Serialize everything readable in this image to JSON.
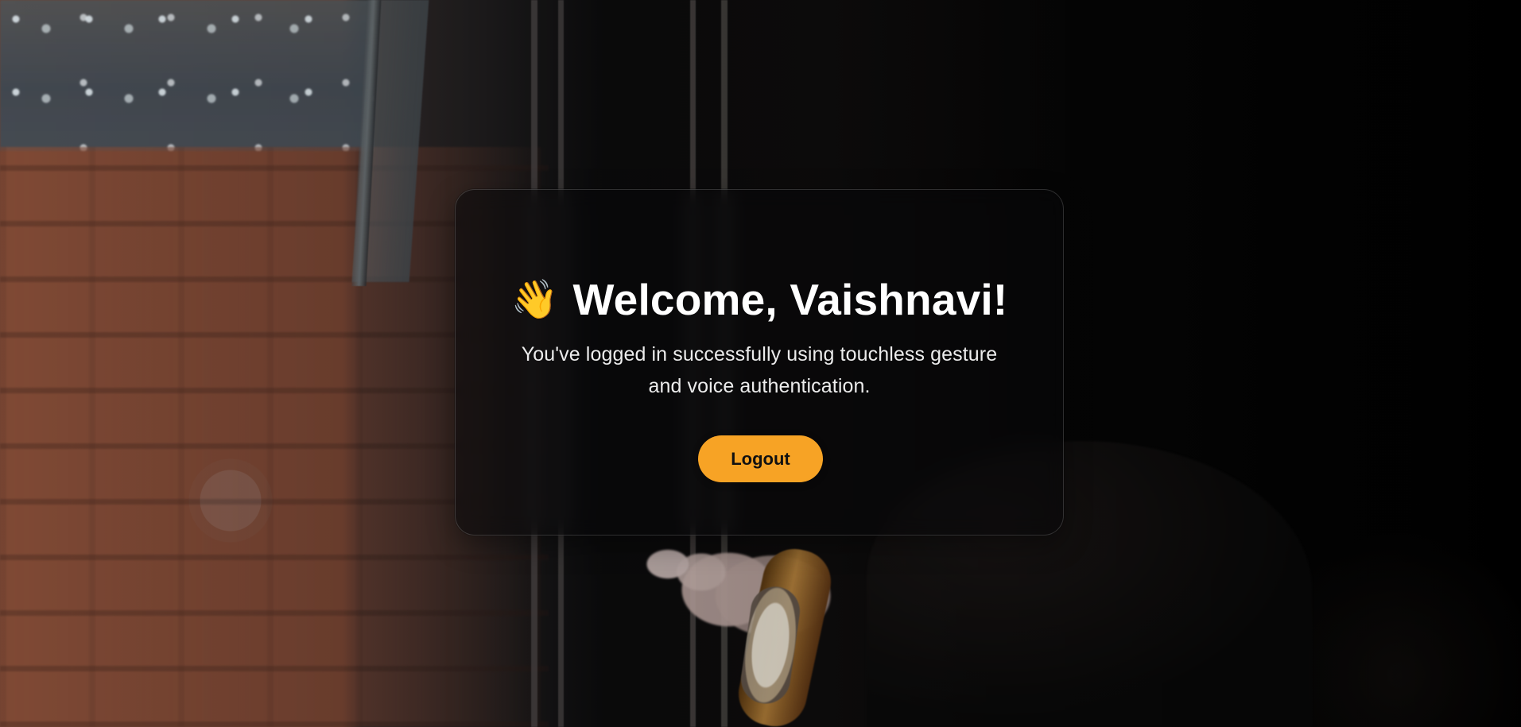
{
  "welcome_card": {
    "heading": {
      "icon": "👋",
      "icon_name": "waving-hand-icon",
      "text": "Welcome, Vaishnavi!"
    },
    "message": "You've logged in successfully using touchless gesture and voice authentication.",
    "logout_button": {
      "label": "Logout",
      "color": "#f7a325"
    }
  },
  "theme": {
    "card_background": "#09090a",
    "text_primary": "#ffffff",
    "text_secondary": "#ececec",
    "accent": "#f7a325"
  }
}
